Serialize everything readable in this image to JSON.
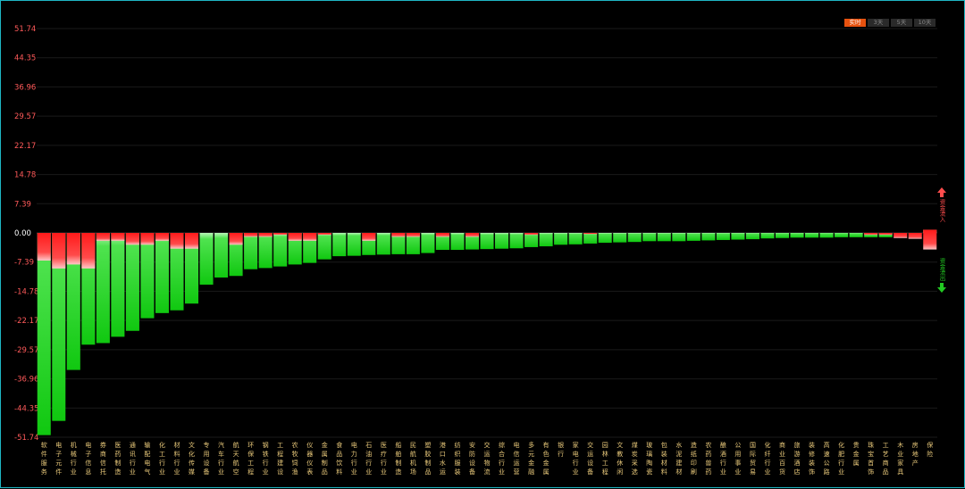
{
  "chart_data": {
    "type": "bar",
    "categories": [
      "软件服务",
      "电子元件",
      "机械行业",
      "电子信息",
      "券商信托",
      "医药制造",
      "通讯行业",
      "输配电气",
      "化工行业",
      "材料行业",
      "文化传媒",
      "专用设备",
      "汽车行业",
      "航天航空",
      "环保工程",
      "钢铁行业",
      "工程建设",
      "农牧饲渔",
      "仪器仪表",
      "金属制品",
      "食品饮料",
      "电力行业",
      "石油行业",
      "医疗行业",
      "船舶制造",
      "民航机场",
      "塑胶制品",
      "港口水运",
      "纺织服装",
      "安防设备",
      "交运物流",
      "综合行业",
      "电信运营",
      "多元金融",
      "有色金属",
      "银行",
      "家电行业",
      "交运设备",
      "园林工程",
      "文教休闲",
      "煤炭采选",
      "玻璃陶瓷",
      "包装材料",
      "水泥建材",
      "造纸印刷",
      "农药兽药",
      "酿酒行业",
      "公用事业",
      "国际贸易",
      "化纤行业",
      "商业百货",
      "旅游酒店",
      "装修装饰",
      "高速公路",
      "化肥行业",
      "贵金属",
      "珠宝首饰",
      "工艺商品",
      "木业家具",
      "房地产",
      "保险"
    ],
    "inflow": [
      7,
      9,
      8,
      9,
      2,
      2,
      3,
      3,
      2,
      4,
      4,
      0,
      0,
      3,
      1,
      1,
      0.5,
      2,
      2,
      0.5,
      0,
      0,
      2,
      0,
      1,
      1,
      0,
      1,
      0,
      1,
      0,
      0,
      0,
      0.5,
      0,
      0,
      0,
      0.3,
      0,
      0,
      0,
      0,
      0,
      0,
      0,
      0,
      0,
      0,
      0,
      0,
      0,
      0,
      0,
      0,
      0,
      0,
      0.5,
      0.5,
      1.3,
      1.5,
      5
    ],
    "outflow": [
      -51.2,
      -47.6,
      -34.7,
      -28.3,
      -27.9,
      -26.3,
      -24.8,
      -21.6,
      -20.3,
      -19.6,
      -17.9,
      -13.1,
      -11.3,
      -10.9,
      -9.2,
      -8.9,
      -8.5,
      -8.0,
      -7.6,
      -6.7,
      -5.9,
      -5.8,
      -5.6,
      -5.5,
      -5.4,
      -5.4,
      -5.1,
      -4.3,
      -4.3,
      -4.2,
      -4.1,
      -4.0,
      -3.9,
      -3.6,
      -3.4,
      -3.0,
      -2.9,
      -2.7,
      -2.5,
      -2.4,
      -2.3,
      -2.1,
      -2.1,
      -2.1,
      -2.0,
      -1.9,
      -1.8,
      -1.7,
      -1.6,
      -1.4,
      -1.3,
      -1.2,
      -1.2,
      -1.2,
      -1.1,
      -1.1,
      -1.1,
      -1.1,
      0,
      0,
      0.8
    ],
    "ticks": [
      "51.74",
      "44.35",
      "36.96",
      "29.57",
      "22.17",
      "14.78",
      "7.39",
      "0.00",
      "-7.39",
      "-14.78",
      "-22.17",
      "-29.57",
      "-36.96",
      "-44.35",
      "-51.74"
    ],
    "ylim": [
      -51.74,
      51.74
    ],
    "grid": true,
    "colors": {
      "inflow": "#ff2020",
      "outflow": "#22d822",
      "zero_tick": "#ffffff",
      "pos_tick": "#ff5a5a",
      "neg_tick": "#ff5a5a",
      "grid": "#1a1a1a"
    }
  },
  "tabs": [
    {
      "label": "实时",
      "active": true
    },
    {
      "label": "3天",
      "active": false
    },
    {
      "label": "5天",
      "active": false
    },
    {
      "label": "10天",
      "active": false
    }
  ],
  "legend": {
    "inflow": "资金流入",
    "outflow": "资金流出"
  }
}
